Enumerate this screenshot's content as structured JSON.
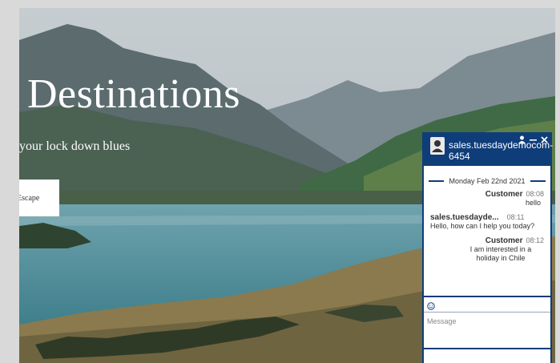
{
  "hero": {
    "title": "Destinations",
    "subtitle": "your lock down blues",
    "button_label": "Escape"
  },
  "chat": {
    "agent_name": "sales.tuesdaydemocom-6454",
    "date_divider": "Monday Feb 22nd 2021",
    "messages": [
      {
        "sender": "Customer",
        "time": "08:08",
        "text": "hello",
        "align": "right"
      },
      {
        "sender": "sales.tuesdayde...",
        "time": "08:11",
        "text": "Hello, how can I help you today?",
        "align": "left"
      },
      {
        "sender": "Customer",
        "time": "08:12",
        "text": "I am interested in a holiday in Chile",
        "align": "right"
      }
    ],
    "message_placeholder": "Message",
    "icons": [
      "person-icon",
      "minimize-icon",
      "close-icon",
      "emoji-icon"
    ]
  },
  "colors": {
    "chat_accent": "#0f3d7a",
    "hero_text": "#ffffff"
  }
}
